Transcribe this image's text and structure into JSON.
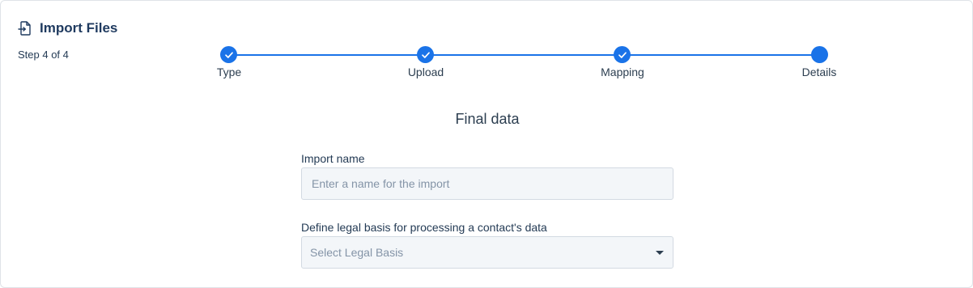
{
  "header": {
    "title": "Import Files",
    "icon": "file-import-icon",
    "step_count": "Step 4 of 4"
  },
  "stepper": {
    "accent_color": "#1a73e8",
    "current_step": 4,
    "steps": [
      {
        "label": "Type",
        "status": "completed",
        "icon": "check-icon"
      },
      {
        "label": "Upload",
        "status": "completed",
        "icon": "check-icon"
      },
      {
        "label": "Mapping",
        "status": "completed",
        "icon": "check-icon"
      },
      {
        "label": "Details",
        "status": "current",
        "icon": ""
      }
    ]
  },
  "form": {
    "title": "Final data",
    "import_name": {
      "label": "Import name",
      "value": "",
      "placeholder": "Enter a name for the import"
    },
    "legal_basis": {
      "label": "Define legal basis for processing a contact's data",
      "selected": "Select Legal Basis",
      "icon": "caret-down-icon"
    }
  }
}
